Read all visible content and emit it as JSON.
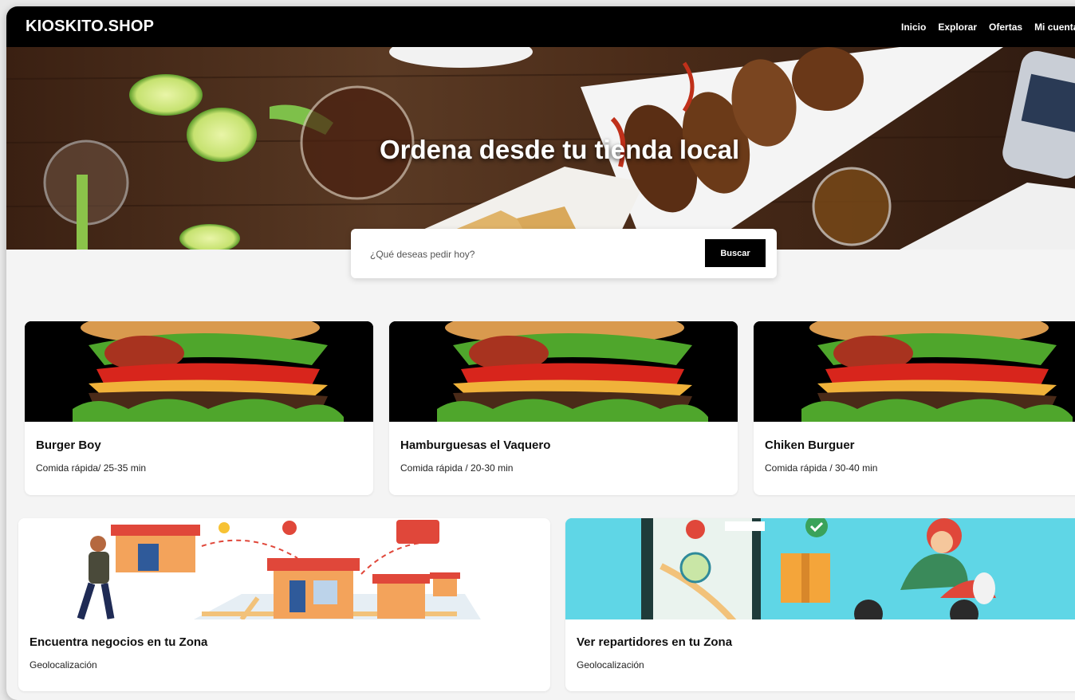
{
  "brand": "KIOSKITO.SHOP",
  "nav": [
    "Inicio",
    "Explorar",
    "Ofertas",
    "Mi cuenta"
  ],
  "hero": {
    "title": "Ordena desde tu tienda local"
  },
  "search": {
    "placeholder": "¿Qué deseas pedir hoy?",
    "button": "Buscar"
  },
  "restaurants": [
    {
      "name": "Burger Boy",
      "meta": "Comida rápida/ 25-35 min"
    },
    {
      "name": "Hamburguesas el Vaquero",
      "meta": "Comida rápida / 20-30 min"
    },
    {
      "name": "Chiken Burguer",
      "meta": "Comida rápida / 30-40 min"
    }
  ],
  "features": [
    {
      "name": "Encuentra negocios en tu Zona",
      "meta": "Geolocalización"
    },
    {
      "name": "Ver repartidores en tu Zona",
      "meta": "Geolocalización"
    }
  ],
  "colors": {
    "nav_bg": "#000000",
    "button_bg": "#000000",
    "page_bg": "#f4f4f4",
    "feature_delivery_bg": "#5fd6e6"
  }
}
